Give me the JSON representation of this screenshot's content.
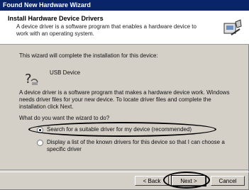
{
  "window": {
    "title": "Found New Hardware Wizard"
  },
  "header": {
    "title": "Install Hardware Device Drivers",
    "subtitle": "A device driver is a software program that enables a hardware device to work with an operating system."
  },
  "body": {
    "intro": "This wizard will complete the installation for this device:",
    "device_name": "USB Device",
    "description": "A device driver is a software program that makes a hardware device work. Windows needs driver files for your new device. To locate driver files and complete the installation click Next.",
    "question": "What do you want the wizard to do?",
    "options": [
      {
        "label": "Search for a suitable driver for my device (recommended)",
        "selected": true
      },
      {
        "label": "Display a list of the known drivers for this device so that I can choose a specific driver",
        "selected": false
      }
    ]
  },
  "buttons": {
    "back": "< Back",
    "next": "Next >",
    "cancel": "Cancel"
  },
  "colors": {
    "titlebar": "#0a246a",
    "dialog": "#d4d0c8"
  }
}
